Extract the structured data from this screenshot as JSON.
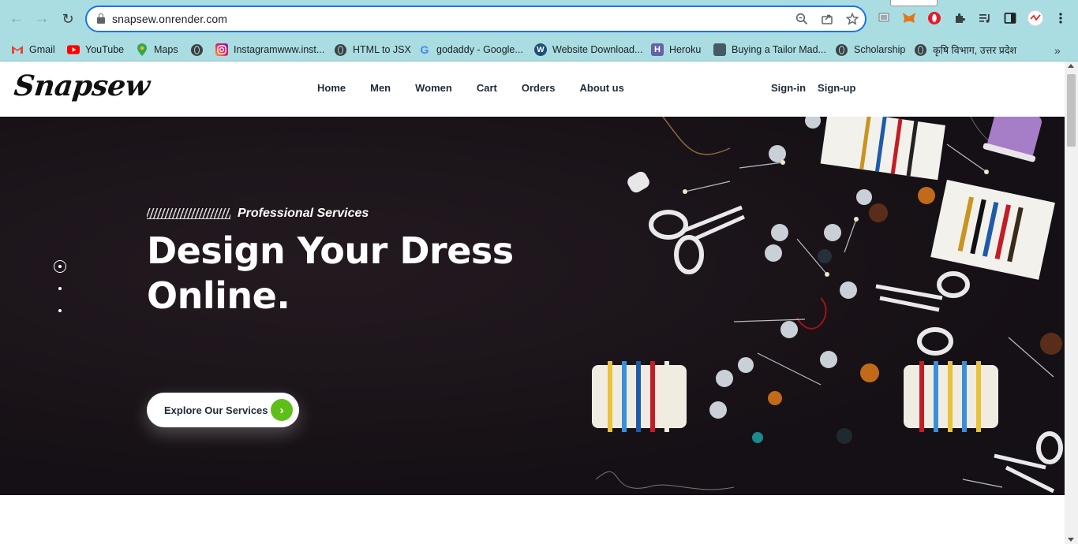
{
  "browser": {
    "url": "snapsew.onrender.com",
    "omnibox_icons": [
      "zoom-icon",
      "share-icon",
      "star-icon"
    ],
    "extensions": [
      "cast-icon",
      "metamask-icon",
      "opera-icon",
      "puzzle-icon",
      "media-icon",
      "sidepanel-icon",
      "profile-icon",
      "menu-icon"
    ]
  },
  "bookmarks": [
    {
      "label": "Gmail",
      "icon": "gmail-icon"
    },
    {
      "label": "YouTube",
      "icon": "youtube-icon"
    },
    {
      "label": "Maps",
      "icon": "maps-icon"
    },
    {
      "label": "",
      "icon": "globe-icon"
    },
    {
      "label": "Instagramwww.inst...",
      "icon": "instagram-icon"
    },
    {
      "label": "HTML to JSX",
      "icon": "globe-icon"
    },
    {
      "label": "godaddy - Google...",
      "icon": "google-icon"
    },
    {
      "label": "Website Download...",
      "icon": "w-icon"
    },
    {
      "label": "Heroku",
      "icon": "heroku-icon"
    },
    {
      "label": "Buying a Tailor Mad...",
      "icon": "site-icon"
    },
    {
      "label": "Scholarship",
      "icon": "globe-icon"
    },
    {
      "label": "कृषि विभाग, उत्तर प्रदेश",
      "icon": "globe-icon"
    }
  ],
  "site": {
    "logo": "Snapsew",
    "menu": [
      "Home",
      "Men",
      "Women",
      "Cart",
      "Orders",
      "About us"
    ],
    "auth": {
      "signin": "Sign-in",
      "signup": "Sign-up"
    }
  },
  "hero": {
    "tagline": "Professional Services",
    "title_line1": "Design Your Dress",
    "title_line2": "Online.",
    "cta_label": "Explore Our Services",
    "slides": 3,
    "active_slide": 1,
    "accent_color": "#5fbf1a",
    "background_color": "#181216"
  }
}
